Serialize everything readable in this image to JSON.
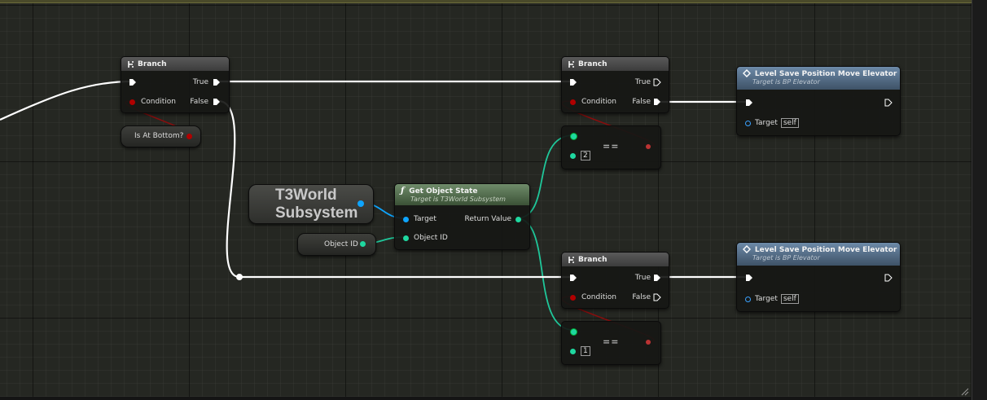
{
  "graph": {
    "branch1": {
      "title": "Branch",
      "true_label": "True",
      "condition_label": "Condition",
      "false_label": "False"
    },
    "is_at_bottom": {
      "label": "Is At Bottom?"
    },
    "subsystem": {
      "line1": "T3World",
      "line2": "Subsystem"
    },
    "object_id_var": {
      "label": "Object ID"
    },
    "get_object_state": {
      "title": "Get Object State",
      "subtitle": "Target is T3World Subsystem",
      "target_label": "Target",
      "return_label": "Return Value",
      "object_id_label": "Object ID"
    },
    "branch2": {
      "title": "Branch",
      "true_label": "True",
      "condition_label": "Condition",
      "false_label": "False"
    },
    "branch3": {
      "title": "Branch",
      "true_label": "True",
      "condition_label": "Condition",
      "false_label": "False"
    },
    "eq_top": {
      "op": "==",
      "value": "2"
    },
    "eq_bottom": {
      "op": "==",
      "value": "1"
    },
    "level_save_top": {
      "title": "Level Save Position Move Elevator",
      "subtitle": "Target is BP Elevator",
      "target_label": "Target",
      "target_value": "self"
    },
    "level_save_bottom": {
      "title": "Level Save Position Move Elevator",
      "subtitle": "Target is BP Elevator",
      "target_label": "Target",
      "target_value": "self"
    }
  },
  "colors": {
    "exec_wire": "#ffffff",
    "bool_pin": "#a30000",
    "int_pin": "#1fd8a0",
    "object_pin": "#0ea5ff",
    "function_header": "#5b7a55",
    "event_header": "#587390"
  }
}
